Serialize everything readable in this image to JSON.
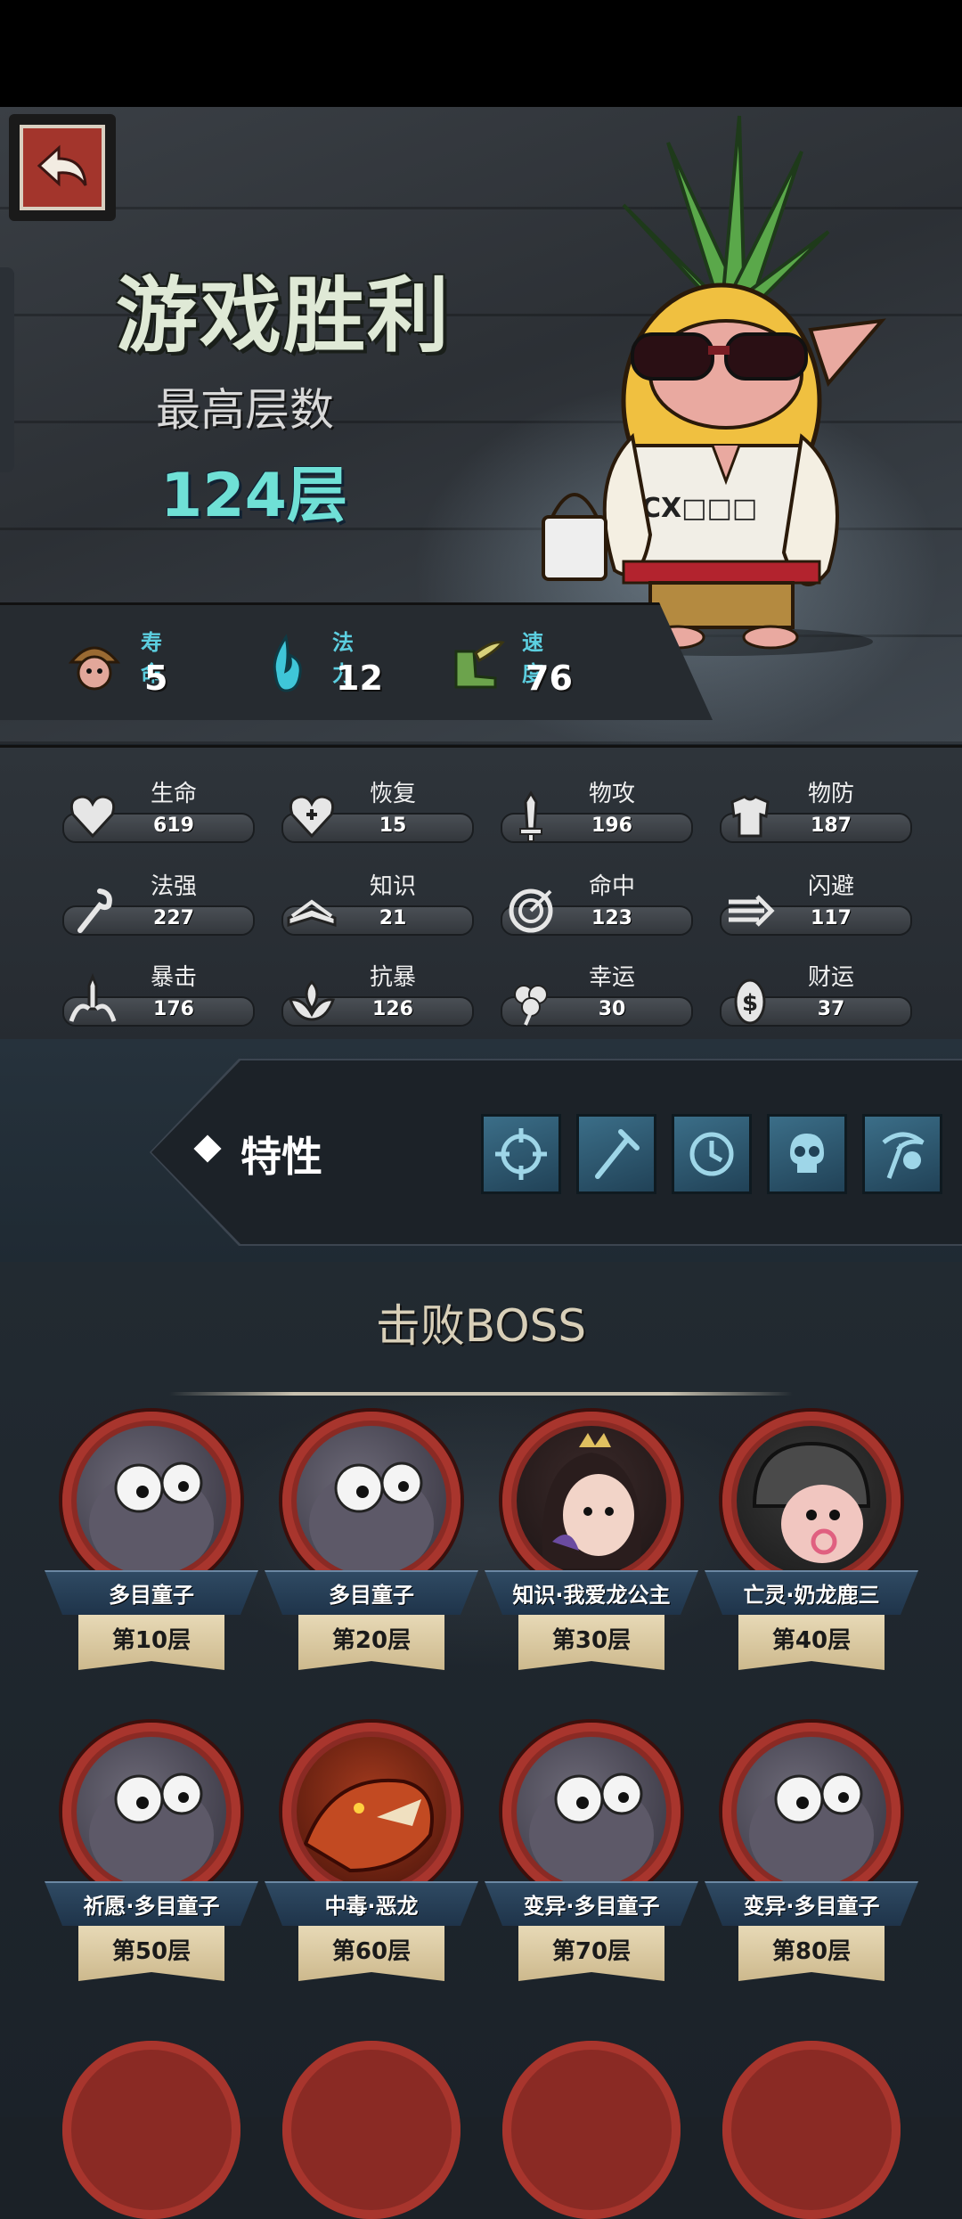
{
  "header": {
    "title": "游戏胜利",
    "best_label": "最高层数",
    "best_value": "124层"
  },
  "basic_stats": [
    {
      "label": "寿命",
      "value": "5",
      "icon": "mushroom-head-icon",
      "color": "#5ccfe0"
    },
    {
      "label": "法力",
      "value": "12",
      "icon": "blue-flame-icon",
      "color": "#5ccfe0"
    },
    {
      "label": "速度",
      "value": "76",
      "icon": "winged-boot-icon",
      "color": "#5ccfe0"
    }
  ],
  "attributes": [
    {
      "label": "生命",
      "value": "619",
      "icon": "heart-icon"
    },
    {
      "label": "恢复",
      "value": "15",
      "icon": "heart-plus-icon"
    },
    {
      "label": "物攻",
      "value": "196",
      "icon": "sword-icon"
    },
    {
      "label": "物防",
      "value": "187",
      "icon": "armor-icon"
    },
    {
      "label": "法强",
      "value": "227",
      "icon": "staff-icon"
    },
    {
      "label": "知识",
      "value": "21",
      "icon": "book-icon"
    },
    {
      "label": "命中",
      "value": "123",
      "icon": "target-icon"
    },
    {
      "label": "闪避",
      "value": "117",
      "icon": "dodge-arrow-icon"
    },
    {
      "label": "暴击",
      "value": "176",
      "icon": "critical-sword-icon"
    },
    {
      "label": "抗暴",
      "value": "126",
      "icon": "shield-flower-icon"
    },
    {
      "label": "幸运",
      "value": "30",
      "icon": "clover-icon"
    },
    {
      "label": "财运",
      "value": "37",
      "icon": "coin-icon"
    }
  ],
  "traits": {
    "label": "特性",
    "icons": [
      "crosshair-trait-icon",
      "staff-trait-icon",
      "clock-trait-icon",
      "skull-trait-icon",
      "reaper-trait-icon"
    ]
  },
  "bosses": {
    "title": "击败BOSS",
    "items": [
      {
        "name": "多目童子",
        "floor": "第10层"
      },
      {
        "name": "多目童子",
        "floor": "第20层"
      },
      {
        "name": "知识·我爱龙公主",
        "floor": "第30层"
      },
      {
        "name": "亡灵·奶龙鹿三",
        "floor": "第40层"
      },
      {
        "name": "祈愿·多目童子",
        "floor": "第50层"
      },
      {
        "name": "中毒·恶龙",
        "floor": "第60层"
      },
      {
        "name": "变异·多目童子",
        "floor": "第70层"
      },
      {
        "name": "变异·多目童子",
        "floor": "第80层"
      }
    ]
  }
}
